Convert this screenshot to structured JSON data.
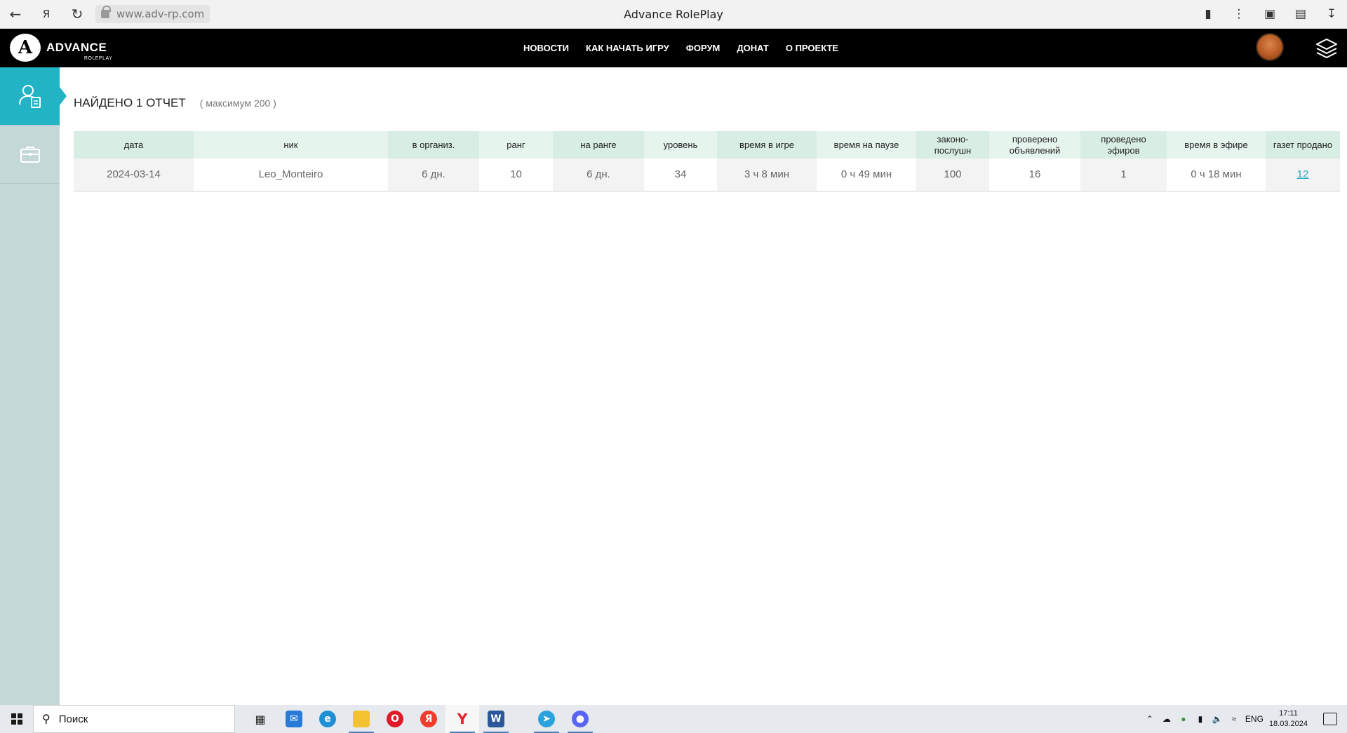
{
  "browser": {
    "url": "www.adv-rp.com",
    "title": "Advance RolePlay"
  },
  "site": {
    "logo_letter": "A",
    "logo_text": "ADVANCE",
    "logo_sub": "ROLEPLAY",
    "nav": [
      "НОВОСТИ",
      "КАК НАЧАТЬ ИГРУ",
      "ФОРУМ",
      "ДОНАТ",
      "О ПРОЕКТЕ"
    ]
  },
  "sidebar": {
    "items": [
      {
        "icon": "user-report-icon",
        "active": true
      },
      {
        "icon": "briefcase-icon",
        "active": false
      }
    ]
  },
  "report": {
    "title": "НАЙДЕНО 1 ОТЧЕТ",
    "subtitle": "( максимум 200 )",
    "columns": [
      "дата",
      "ник",
      "в организ.",
      "ранг",
      "на ранге",
      "уровень",
      "время в игре",
      "время на паузе",
      "законо-\nпослушн",
      "проверено\nобъявлений",
      "проведено\nэфиров",
      "время в эфире",
      "газет продано"
    ],
    "rows": [
      [
        "2024-03-14",
        "Leo_Monteiro",
        "6 дн.",
        "10",
        "6 дн.",
        "34",
        "3 ч 8 мин",
        "0 ч 49 мин",
        "100",
        "16",
        "1",
        "0 ч 18 мин",
        "12"
      ]
    ]
  },
  "taskbar": {
    "search_placeholder": "Поиск",
    "apps": [
      {
        "name": "task-view-icon"
      },
      {
        "name": "mail-icon"
      },
      {
        "name": "edge-icon"
      },
      {
        "name": "file-explorer-icon"
      },
      {
        "name": "opera-icon"
      },
      {
        "name": "yandex-icon"
      },
      {
        "name": "yandex-browser-icon"
      },
      {
        "name": "word-icon"
      },
      {
        "name": "telegram-icon"
      },
      {
        "name": "discord-icon"
      }
    ],
    "lang": "ENG",
    "time": "17:11",
    "date": "18.03.2024"
  },
  "colors": {
    "header_bg": "#000000",
    "accent": "#22b3c4",
    "sidebar_bg": "#c5d8d8",
    "table_header_a": "#d8ede4",
    "table_header_b": "#e6f4ee",
    "link": "#2aa7c2"
  }
}
